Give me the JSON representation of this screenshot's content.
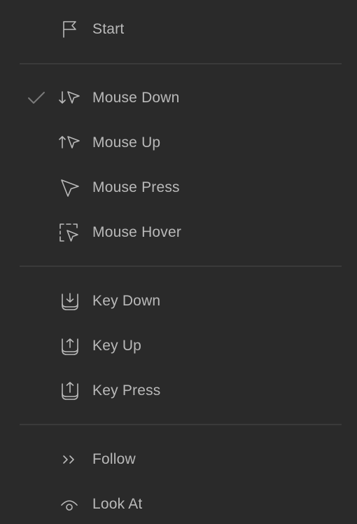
{
  "colors": {
    "background": "#2a2a2a",
    "text": "#b9b9b9",
    "divider": "#3a3a3a",
    "check": "#7a7a7a"
  },
  "menu": {
    "start": {
      "label": "Start",
      "icon": "flag-icon"
    },
    "mouse": [
      {
        "label": "Mouse Down",
        "icon": "mouse-down-icon",
        "checked": true
      },
      {
        "label": "Mouse Up",
        "icon": "mouse-up-icon",
        "checked": false
      },
      {
        "label": "Mouse Press",
        "icon": "cursor-icon",
        "checked": false
      },
      {
        "label": "Mouse Hover",
        "icon": "hover-cursor-icon",
        "checked": false
      }
    ],
    "keys": [
      {
        "label": "Key Down",
        "icon": "key-down-icon"
      },
      {
        "label": "Key Up",
        "icon": "key-up-icon"
      },
      {
        "label": "Key Press",
        "icon": "key-press-icon"
      }
    ],
    "other": [
      {
        "label": "Follow",
        "icon": "chevrons-right-icon"
      },
      {
        "label": "Look At",
        "icon": "eye-icon"
      }
    ]
  }
}
